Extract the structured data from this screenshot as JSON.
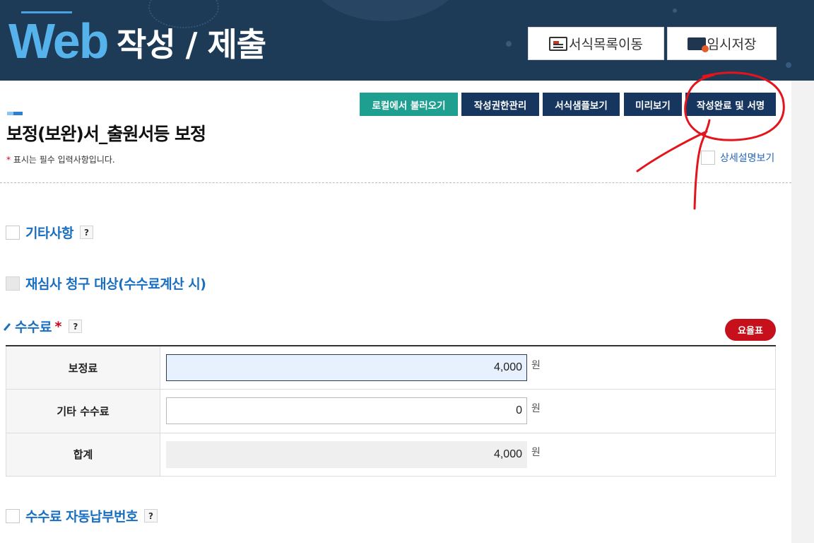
{
  "header": {
    "logo_text": "Web",
    "title": "작성 / 제출",
    "btn_form_list": "서식목록이동",
    "btn_temp_save": "임시저장",
    "icons": [
      "form-list-icon",
      "folder-save-icon"
    ]
  },
  "toolbar": {
    "load_local": "로컬에서 불러오기",
    "permission": "작성권한관리",
    "sample": "서식샘플보기",
    "preview": "미리보기",
    "complete_sign": "작성완료 및 서명",
    "colors": {
      "teal": "#1f9f8f",
      "navy": "#17365f"
    }
  },
  "page": {
    "title": "보정(보완)서_출원서등 보정",
    "required_star": "*",
    "required_note": " 표시는 필수 입력사항입니다.",
    "detail_toggle": "상세설명보기"
  },
  "sections": {
    "etc": "기타사항",
    "reexam": "재심사 청구 대상(수수료계산 시)",
    "fee": "수수료",
    "fee_star": "*",
    "auto_pay": "수수료 자동납부번호",
    "help": "?"
  },
  "fee_table": {
    "rate_button": "요율표",
    "rows": [
      {
        "label": "보정료",
        "value": "4,000",
        "unit": "원"
      },
      {
        "label": "기타 수수료",
        "value": "0",
        "unit": "원"
      },
      {
        "label": "합계",
        "value": "4,000",
        "unit": "원"
      }
    ]
  },
  "colors": {
    "banner": "#1d3a57",
    "accent_blue": "#1a6fc0",
    "rate_red": "#c6101b",
    "annotation_red": "#e3141c"
  }
}
